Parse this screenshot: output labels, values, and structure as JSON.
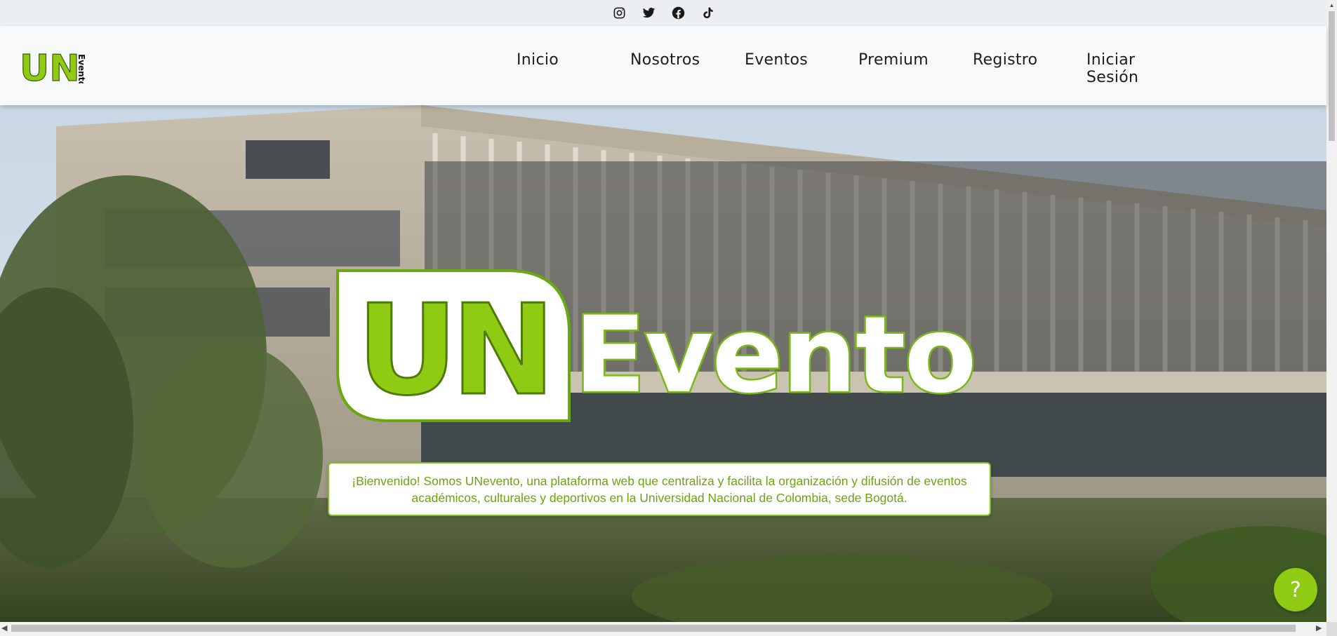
{
  "social": {
    "items": [
      {
        "icon": "instagram-icon"
      },
      {
        "icon": "twitter-icon"
      },
      {
        "icon": "facebook-icon"
      },
      {
        "icon": "tiktok-icon"
      }
    ]
  },
  "header": {
    "logo": {
      "letters": "UN",
      "word": "Evento"
    },
    "nav": {
      "inicio": "Inicio",
      "nosotros": "Nosotros",
      "eventos": "Eventos",
      "premium": "Premium",
      "registro": "Registro",
      "login_line1": "Iniciar",
      "login_line2": "Sesión"
    }
  },
  "hero": {
    "logo": {
      "letters": "UN",
      "word": "Evento"
    },
    "welcome": "¡Bienvenido! Somos UNevento, una plataforma web que centraliza y facilita la organización y difusión de eventos académicos, culturales y deportivos en la Universidad Nacional de Colombia, sede Bogotá."
  },
  "help_button": {
    "label": "?"
  },
  "colors": {
    "accent_green": "#8ecb12",
    "text_green": "#6ba40e",
    "header_bg": "#f7f9fb",
    "social_bar_bg": "#eceff1"
  }
}
